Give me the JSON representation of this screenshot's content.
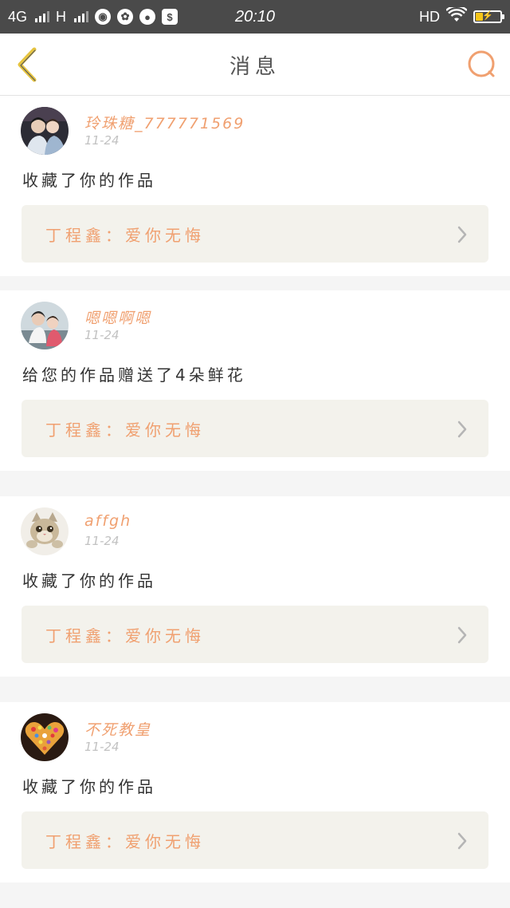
{
  "status_bar": {
    "network": "4G",
    "network2": "H",
    "time": "20:10",
    "hd": "HD",
    "battery_level": 0.3,
    "battery_fill_color": "#f5c518"
  },
  "nav": {
    "title": "消息",
    "back_icon": "chevron-left-icon",
    "back_icon_color": "#e6c440",
    "search_icon": "search-icon",
    "search_icon_color": "#f0a070"
  },
  "colors": {
    "accent": "#f0a070",
    "card_bg": "#ffffff",
    "link_bg": "#f3f2ec",
    "divider_bg": "#f5f5f5"
  },
  "messages": [
    {
      "username": "玲珠糖_777771569",
      "date": "11-24",
      "action": "收藏了你的作品",
      "work": "丁程鑫：爱你无悔"
    },
    {
      "username": "嗯嗯啊嗯",
      "date": "11-24",
      "action": "给您的作品赠送了4朵鲜花",
      "work": "丁程鑫：爱你无悔"
    },
    {
      "username": "affgh",
      "date": "11-24",
      "action": "收藏了你的作品",
      "work": "丁程鑫：爱你无悔"
    },
    {
      "username": "不死教皇",
      "date": "11-24",
      "action": "收藏了你的作品",
      "work": "丁程鑫：爱你无悔"
    }
  ]
}
